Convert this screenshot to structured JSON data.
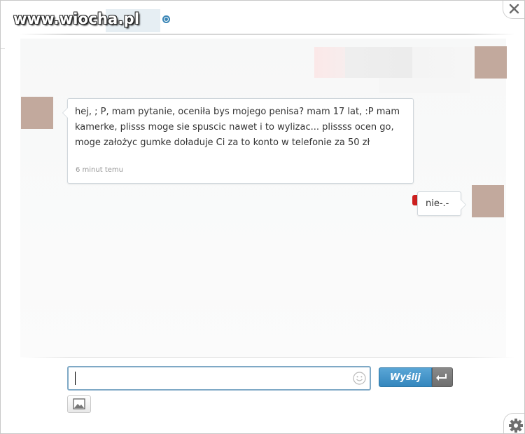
{
  "watermark": {
    "text": "www.wiocha.pl"
  },
  "header": {
    "contact_name": "",
    "status": "online"
  },
  "conversation": {
    "incoming": {
      "text": "hej, ; P, mam pytanie, oceniła bys mojego penisa? mam 17 lat, :P mam kamerke, plisss moge sie spuscic nawet i to wylizac... plissss ocen go, moge założyc gumke doładuje Ci za to konto w telefonie za 50 zł",
      "time": "6 minut temu"
    },
    "outgoing": {
      "text": "nie-.-",
      "unread_flag_color": "#cc1f1f"
    }
  },
  "composer": {
    "input_value": "",
    "placeholder": "",
    "send_label": "Wyślij",
    "emoji_icon": "smiley-icon",
    "enter_icon": "enter-arrow-icon",
    "image_icon": "image-icon"
  },
  "colors": {
    "accent": "#3486bd",
    "avatar": "#c2a99d",
    "online": "#3b86b6"
  },
  "controls": {
    "close_icon": "close-icon",
    "settings_icon": "gear-icon"
  }
}
